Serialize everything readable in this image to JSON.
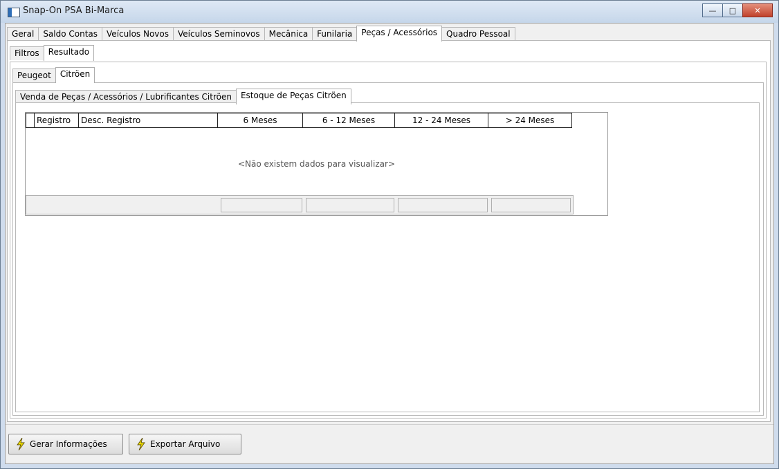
{
  "window": {
    "title": "Snap-On PSA Bi-Marca",
    "minimize": "—",
    "maximize": "□",
    "close": "✕"
  },
  "main_tabs": [
    "Geral",
    "Saldo Contas",
    "Veículos Novos",
    "Veículos Seminovos",
    "Mecânica",
    "Funilaria",
    "Peças / Acessórios",
    "Quadro Pessoal"
  ],
  "sub_tabs": [
    "Filtros",
    "Resultado"
  ],
  "brand_tabs": [
    "Peugeot",
    "Citröen"
  ],
  "report_tabs": [
    "Venda de Peças / Acessórios / Lubrificantes Citröen",
    "Estoque de Peças Citröen"
  ],
  "grid": {
    "columns": [
      "",
      "Registro",
      "Desc. Registro",
      "6 Meses",
      "6 - 12 Meses",
      "12 - 24 Meses",
      "> 24 Meses"
    ],
    "empty_message": "<Não existem dados para visualizar>"
  },
  "buttons": {
    "generate": "Gerar Informações",
    "export": "Exportar Arquivo"
  }
}
